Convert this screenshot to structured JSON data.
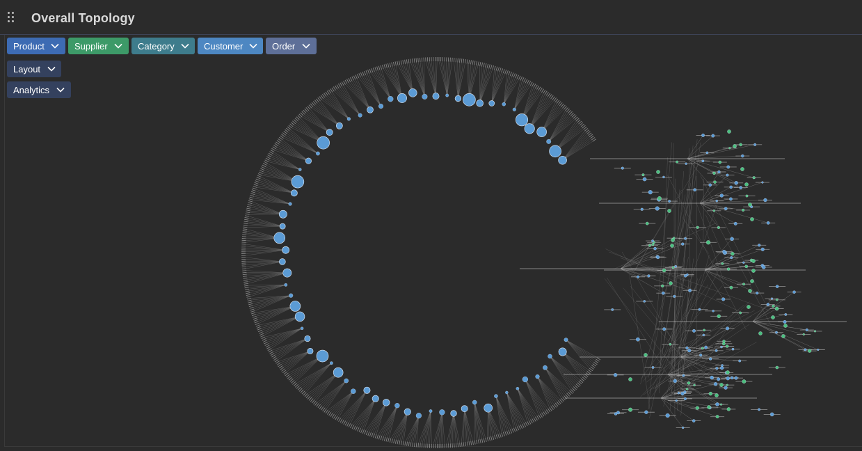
{
  "header": {
    "title": "Overall Topology",
    "drag_icon": "drag-handle-icon"
  },
  "filters": [
    {
      "label": "Product",
      "color": "#3d6bb3"
    },
    {
      "label": "Supplier",
      "color": "#3d9a68"
    },
    {
      "label": "Category",
      "color": "#3e7c8c"
    },
    {
      "label": "Customer",
      "color": "#4d87c2"
    },
    {
      "label": "Order",
      "color": "#5e6f98"
    }
  ],
  "controls": [
    {
      "label": "Layout",
      "color": "#34415e"
    },
    {
      "label": "Analytics",
      "color": "#34415e"
    }
  ],
  "chevron_icon": "chevron-down-icon",
  "legend_colors": {
    "product_node": "#5b9bd5",
    "supplier_node": "#4bbf7f",
    "edge": "#9a9a9a",
    "label": "#cfcfcf"
  }
}
